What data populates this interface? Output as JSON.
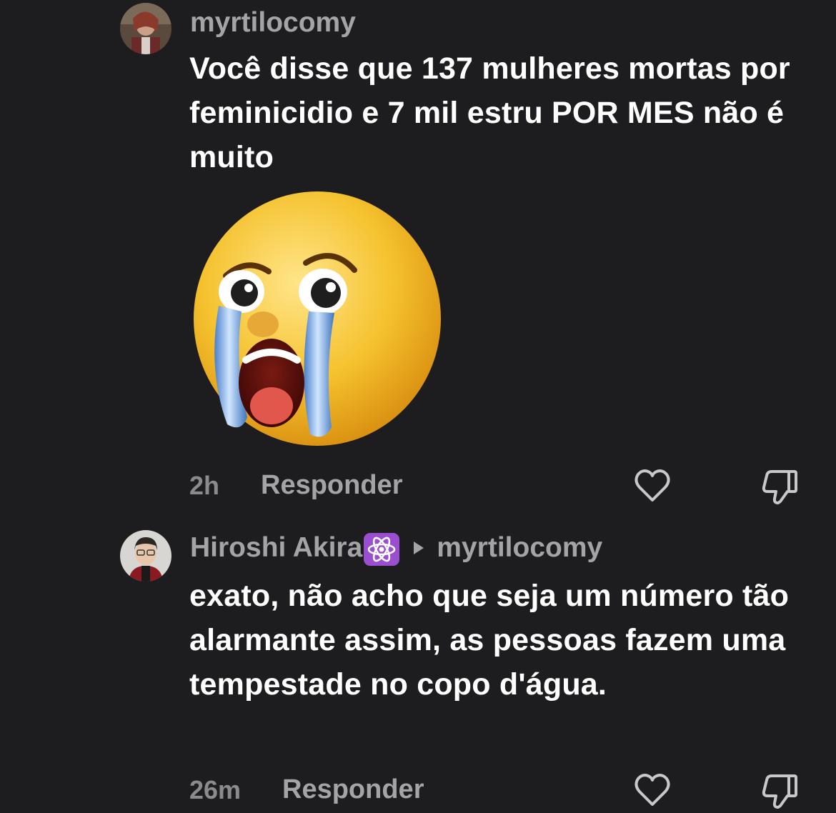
{
  "comments": [
    {
      "username": "myrtilocomy",
      "text": "Você disse que 137 mulheres mortas por feminicidio e 7 mil estru POR MES não é muito",
      "sticker": "loudly-crying-face-emoji",
      "time": "2h",
      "reply_label": "Responder"
    },
    {
      "username": "Hiroshi Akira",
      "badge_icon": "atom-symbol-icon",
      "reply_to": "myrtilocomy",
      "text": "exato, não acho que seja um número tão alarmante assim, as pessoas fazem uma tempestade no copo d'água.",
      "time": "26m",
      "reply_label": "Responder"
    }
  ],
  "icons": {
    "like": "heart-icon",
    "dislike": "thumbs-down-icon"
  },
  "colors": {
    "background": "#1d1d1f",
    "text": "#ffffff",
    "muted": "#a3a3a8",
    "badge": "#9a4fd0"
  }
}
